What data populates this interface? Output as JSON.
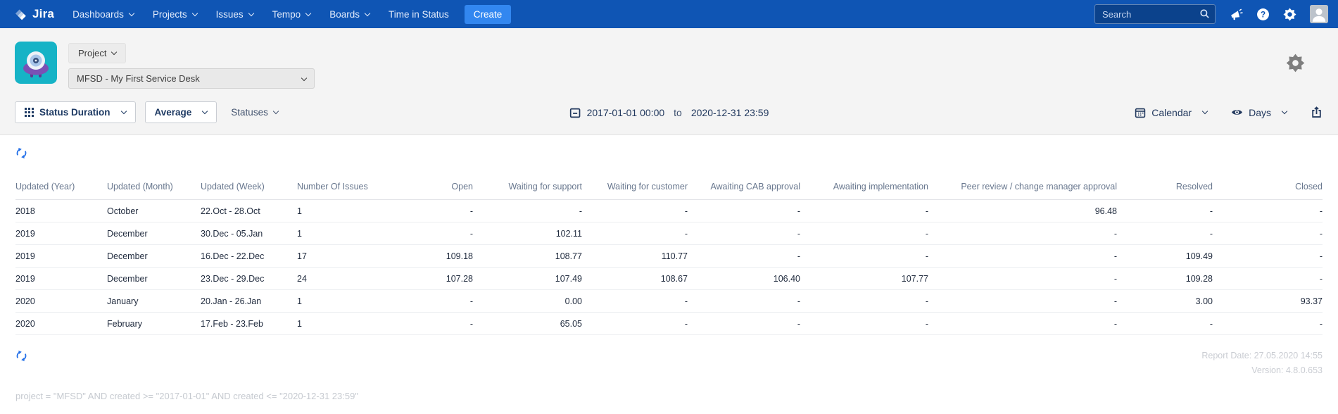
{
  "navbar": {
    "brand": "Jira",
    "items": [
      {
        "label": "Dashboards",
        "caret": true
      },
      {
        "label": "Projects",
        "caret": true
      },
      {
        "label": "Issues",
        "caret": true
      },
      {
        "label": "Tempo",
        "caret": true
      },
      {
        "label": "Boards",
        "caret": true
      },
      {
        "label": "Time in Status",
        "caret": false
      }
    ],
    "create_label": "Create",
    "search_placeholder": "Search"
  },
  "project_bar": {
    "selector_label": "Project",
    "selected_project": "MFSD - My First Service Desk"
  },
  "toolbar": {
    "report_type": "Status Duration",
    "aggregation": "Average",
    "statuses_label": "Statuses",
    "date_from": "2017-01-01 00:00",
    "date_separator": "to",
    "date_to": "2020-12-31 23:59",
    "calendar_label": "Calendar",
    "unit_label": "Days"
  },
  "table": {
    "columns": [
      "Updated (Year)",
      "Updated (Month)",
      "Updated (Week)",
      "Number Of Issues",
      "Open",
      "Waiting for support",
      "Waiting for customer",
      "Awaiting CAB approval",
      "Awaiting implementation",
      "Peer review / change manager approval",
      "Resolved",
      "Closed"
    ],
    "rows": [
      [
        "2018",
        "October",
        "22.Oct - 28.Oct",
        "1",
        "-",
        "-",
        "-",
        "-",
        "-",
        "96.48",
        "-",
        "-"
      ],
      [
        "2019",
        "December",
        "30.Dec - 05.Jan",
        "1",
        "-",
        "102.11",
        "-",
        "-",
        "-",
        "-",
        "-",
        "-"
      ],
      [
        "2019",
        "December",
        "16.Dec - 22.Dec",
        "17",
        "109.18",
        "108.77",
        "110.77",
        "-",
        "-",
        "-",
        "109.49",
        "-"
      ],
      [
        "2019",
        "December",
        "23.Dec - 29.Dec",
        "24",
        "107.28",
        "107.49",
        "108.67",
        "106.40",
        "107.77",
        "-",
        "109.28",
        "-"
      ],
      [
        "2020",
        "January",
        "20.Jan - 26.Jan",
        "1",
        "-",
        "0.00",
        "-",
        "-",
        "-",
        "-",
        "3.00",
        "93.37"
      ],
      [
        "2020",
        "February",
        "17.Feb - 23.Feb",
        "1",
        "-",
        "65.05",
        "-",
        "-",
        "-",
        "-",
        "-",
        "-"
      ]
    ]
  },
  "footer": {
    "report_date": "Report Date: 27.05.2020 14:55",
    "version": "Version: 4.8.0.653",
    "query": "project = \"MFSD\" AND created >= \"2017-01-01\" AND created <= \"2020-12-31 23:59\""
  },
  "colors": {
    "navbar_bg": "#0f55b4",
    "create_button": "#3287f0",
    "accent_blue": "#2470e8",
    "band_bg": "#f4f4f4",
    "project_avatar_teal": "#16b3c6",
    "project_avatar_purple": "#7a51b5"
  }
}
